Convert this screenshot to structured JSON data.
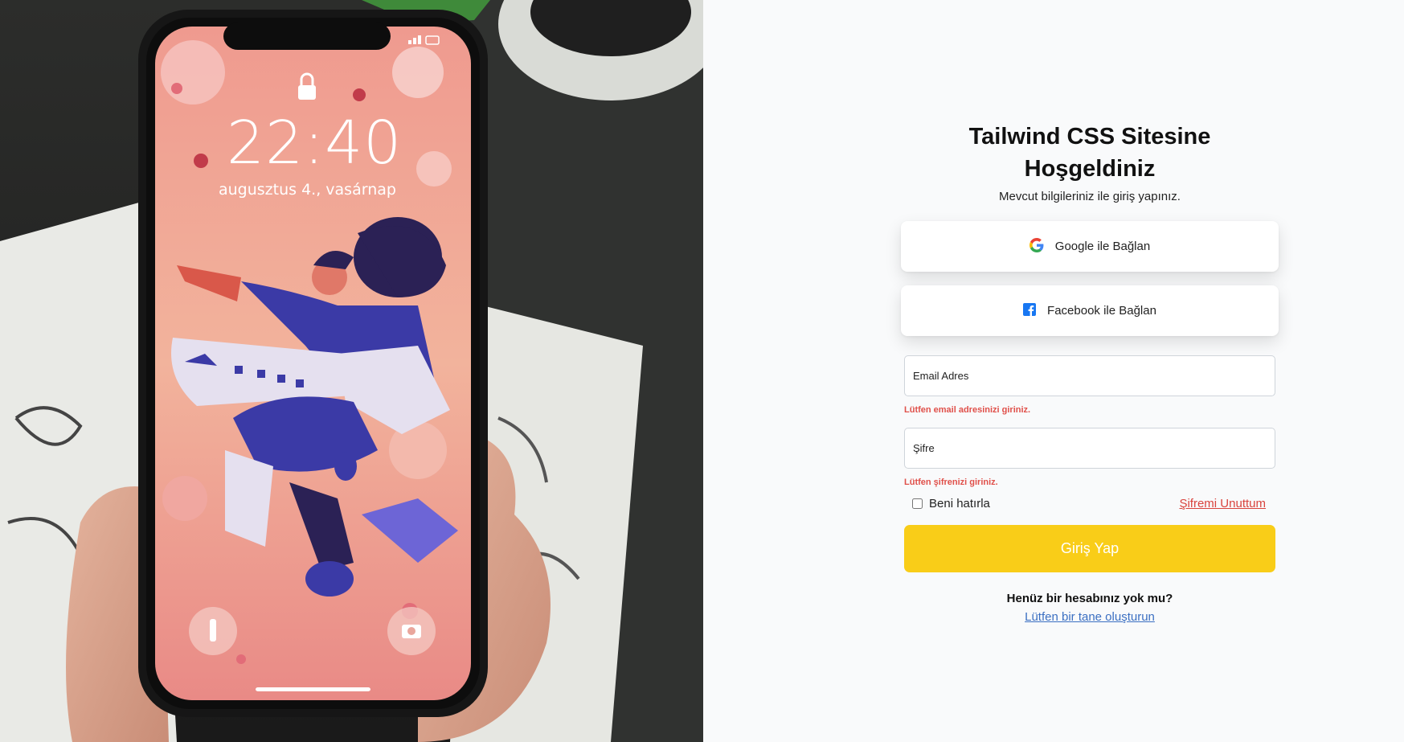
{
  "photo": {
    "clock": "22:40",
    "date": "augusztus 4., vasárnap"
  },
  "login": {
    "title": "Tailwind CSS Sitesine Hoşgeldiniz",
    "subtitle": "Mevcut bilgileriniz ile giriş yapınız.",
    "google_label": "Google ile Bağlan",
    "facebook_label": "Facebook ile Bağlan",
    "email_placeholder": "Email Adres",
    "email_error": "Lütfen email adresinizi giriniz.",
    "password_placeholder": "Şifre",
    "password_error": "Lütfen şifrenizi giriniz.",
    "remember_label": "Beni hatırla",
    "forgot_label": "Şifremi Unuttum",
    "submit_label": "Giriş Yap",
    "no_account_text": "Henüz bir hesabınız yok mu?",
    "create_account_link": "Lütfen bir tane oluşturun"
  },
  "colors": {
    "accent_yellow": "#f9cd18",
    "error_red": "#e0504a",
    "link_blue": "#3b6fc2",
    "facebook_blue": "#1877f2"
  }
}
